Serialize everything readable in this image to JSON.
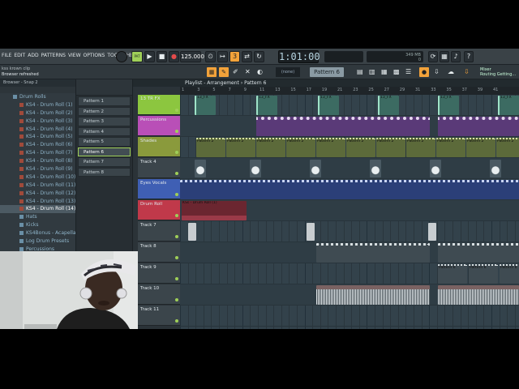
{
  "menu": [
    "FILE",
    "EDIT",
    "ADD",
    "PATTERNS",
    "VIEW",
    "OPTIONS",
    "TOOLS",
    "HELP"
  ],
  "transport": {
    "bpm": "125.000",
    "time": "1:01:00",
    "mode_label": "PAT"
  },
  "cpu": {
    "memory": "349 MB",
    "cpu": "0"
  },
  "mixer": {
    "title": "Mixer",
    "subtitle": "Routing Getting..."
  },
  "hint": {
    "line1": "kss krown clip",
    "line2": "Browser refreshed"
  },
  "snap": "(none)",
  "current_pattern": "Pattern 6",
  "browser": {
    "title": "Browser - Snap 2",
    "items": [
      {
        "label": "Drum Rolls",
        "kind": "folder"
      },
      {
        "label": "KS4 - Drum Roll (1)"
      },
      {
        "label": "KS4 - Drum Roll (2)"
      },
      {
        "label": "KS4 - Drum Roll (3)"
      },
      {
        "label": "KS4 - Drum Roll (4)"
      },
      {
        "label": "KS4 - Drum Roll (5)"
      },
      {
        "label": "KS4 - Drum Roll (6)"
      },
      {
        "label": "KS4 - Drum Roll (7)"
      },
      {
        "label": "KS4 - Drum Roll (8)"
      },
      {
        "label": "KS4 - Drum Roll (9)"
      },
      {
        "label": "KS4 - Drum Roll (10)"
      },
      {
        "label": "KS4 - Drum Roll (11)"
      },
      {
        "label": "KS4 - Drum Roll (12)"
      },
      {
        "label": "KS4 - Drum Roll (13)"
      },
      {
        "label": "KS4 - Drum Roll (14)",
        "selected": true
      },
      {
        "label": "Hats",
        "kind": "folder"
      },
      {
        "label": "Kicks",
        "kind": "folder"
      },
      {
        "label": "KS4Bonus - Acapella",
        "kind": "folder"
      },
      {
        "label": "Log Drum Presets",
        "kind": "folder"
      },
      {
        "label": "Percussions",
        "kind": "folder"
      }
    ]
  },
  "patterns": [
    "Pattern 1",
    "Pattern 2",
    "Pattern 3",
    "Pattern 4",
    "Pattern 5",
    "Pattern 6",
    "Pattern 7",
    "Pattern 8"
  ],
  "selected_pattern_index": 5,
  "playlist": {
    "title": "Playlist - Arrangement",
    "pattern": "Pattern 6",
    "ruler": [
      "1",
      "3",
      "5",
      "7",
      "9",
      "11",
      "13",
      "15",
      "17",
      "19",
      "21",
      "23",
      "25",
      "27",
      "29",
      "31",
      "33",
      "35",
      "37",
      "39",
      "41"
    ],
    "tracks": [
      {
        "name": "13 TR FX",
        "color": "#8cc63f",
        "clip": "13_FX",
        "kind": "fx"
      },
      {
        "name": "Percussions",
        "color": "#b94fb7",
        "clip": "",
        "kind": "perc"
      },
      {
        "name": "Shades",
        "color": "#8a9a3c",
        "clip": "Pattern 2",
        "kind": "shades"
      },
      {
        "name": "Track 4",
        "color": "",
        "clip": "",
        "kind": "hits"
      },
      {
        "name": "Eyes Vocals",
        "color": "#3f5fb4",
        "clip": "",
        "kind": "vocal"
      },
      {
        "name": "Drum Roll",
        "color": "#c0394a",
        "clip": "KSs - Drum Roll (1)",
        "kind": "roll"
      },
      {
        "name": "Track 7",
        "color": "",
        "clip": "",
        "kind": "blips"
      },
      {
        "name": "Track 8",
        "color": "",
        "clip": "",
        "kind": "dots"
      },
      {
        "name": "Track 9",
        "color": "",
        "clip": "Pattern 6",
        "kind": "p6"
      },
      {
        "name": "Track 10",
        "color": "",
        "clip": "",
        "kind": "wave"
      },
      {
        "name": "Track 11",
        "color": "",
        "clip": "",
        "kind": "empty"
      }
    ]
  },
  "colors": {
    "accent": "#f2a23a",
    "green": "#8cc63f",
    "grid": "#33424b"
  }
}
